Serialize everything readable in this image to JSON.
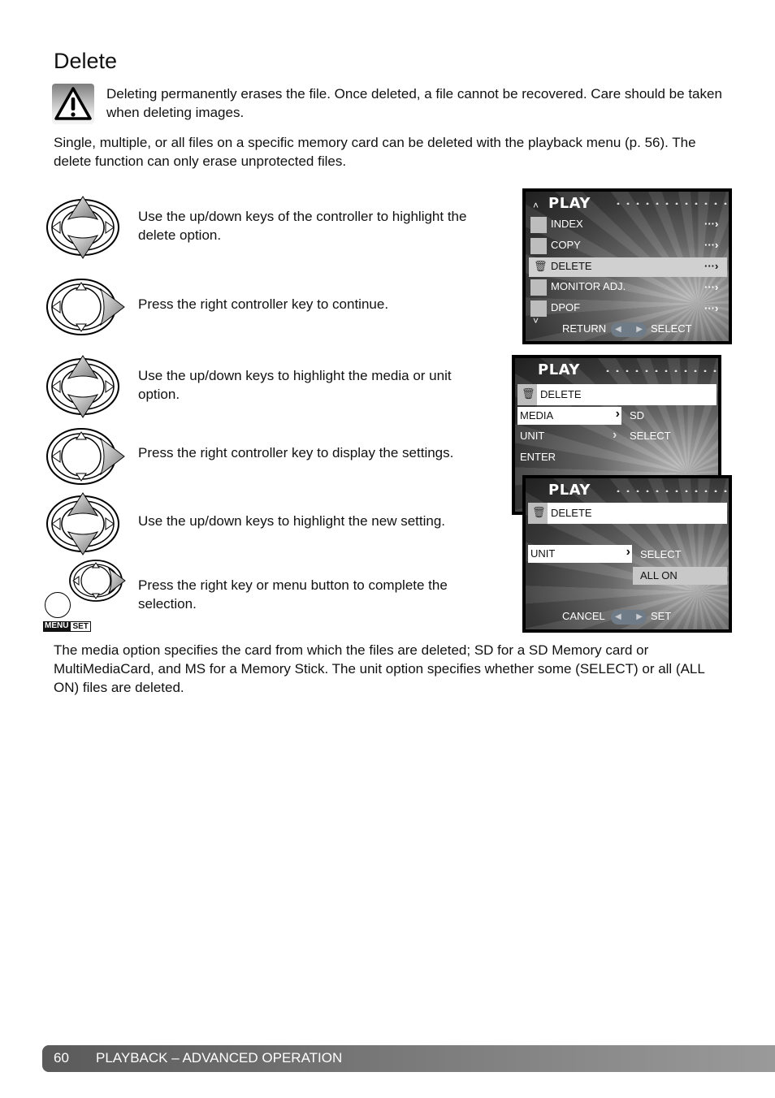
{
  "page": {
    "title": "Delete",
    "warning_text": "Deleting permanently erases the file. Once deleted, a file cannot be recovered. Care should be taken when deleting images.",
    "intro_text": "Single, multiple, or all files on a specific memory card can be deleted with the playback menu (p. 56). The delete function can only erase unprotected files.",
    "closing_text": "The media option specifies the card from which the files are deleted; SD for a SD Memory card or MultiMediaCard, and MS for a Memory Stick. The unit option specifies whether some (SELECT) or all (ALL ON) files are deleted."
  },
  "steps": [
    {
      "controller": "up-down",
      "text": "Use the up/down keys of the controller to highlight the delete option."
    },
    {
      "controller": "right",
      "text": "Press the right controller key to continue."
    },
    {
      "controller": "up-down",
      "text": "Use the up/down keys to highlight the media or unit option."
    },
    {
      "controller": "right",
      "text": "Press the right controller key to display the settings."
    },
    {
      "controller": "up-down",
      "text": "Use the up/down keys to highlight the new setting."
    },
    {
      "controller": "right-menu",
      "text": "Press the right key or menu button to complete the selection.",
      "menu_label": "MENU",
      "set_label": "SET"
    }
  ],
  "screen1": {
    "header": "PLAY",
    "items": [
      {
        "icon": "index-icon",
        "label": "INDEX",
        "arrow": "···›"
      },
      {
        "icon": "copy-icon",
        "label": "COPY",
        "arrow": "···›"
      },
      {
        "icon": "trash-icon",
        "label": "DELETE",
        "arrow": "···›",
        "highlighted": true
      },
      {
        "icon": "monitor-adjust-icon",
        "label": "MONITOR ADJ.",
        "arrow": "···›"
      },
      {
        "icon": "dpof-icon",
        "label": "DPOF",
        "arrow": "···›"
      }
    ],
    "scroll_up": "˄",
    "scroll_down": "˅",
    "footer_left": "RETURN",
    "footer_right": "SELECT"
  },
  "screen2": {
    "header": "PLAY",
    "title_row": "DELETE",
    "rows": [
      {
        "label": "MEDIA",
        "value": "SD",
        "highlighted": true
      },
      {
        "label": "UNIT",
        "value": "SELECT"
      },
      {
        "label": "ENTER",
        "value": ""
      }
    ]
  },
  "screen3": {
    "header": "PLAY",
    "title_row": "DELETE",
    "row_label": "UNIT",
    "options": [
      {
        "label": "SELECT",
        "selected": false
      },
      {
        "label": "ALL ON",
        "selected": true
      }
    ],
    "footer_left": "CANCEL",
    "footer_right": "SET"
  },
  "footer": {
    "page_number": "60",
    "section": "PLAYBACK – ADVANCED OPERATION"
  }
}
